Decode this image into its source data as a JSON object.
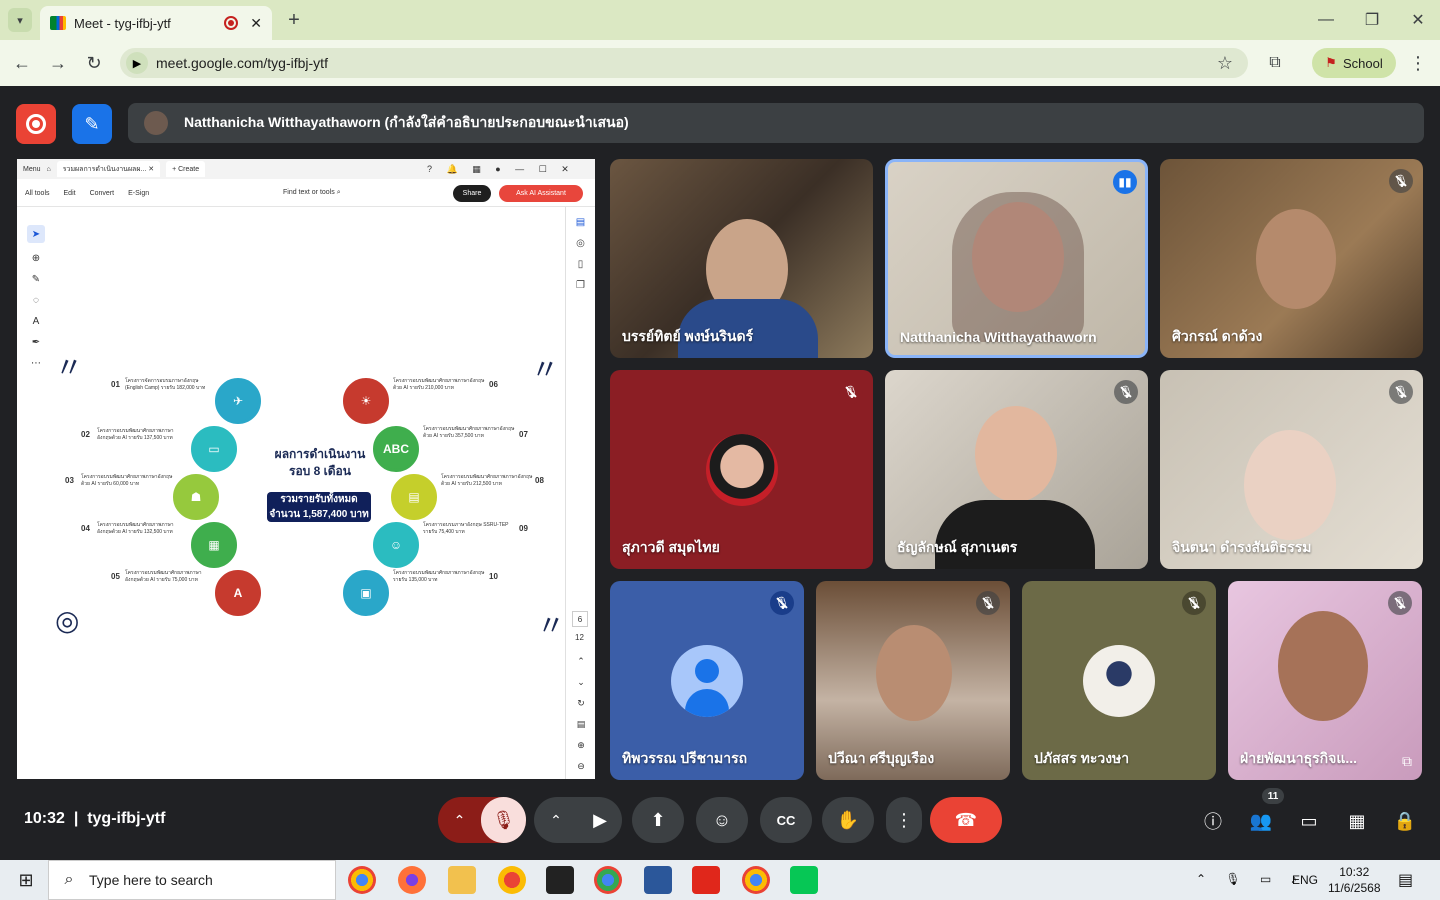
{
  "browser": {
    "tab_title": "Meet - tyg-ifbj-ytf",
    "url": "meet.google.com/tyg-ifbj-ytf",
    "profile_label": "School"
  },
  "meet": {
    "presenter_banner": "Natthanicha Witthayathaworn (กำลังใส่คำอธิบายประกอบขณะนำเสนอ)",
    "time": "10:32",
    "meeting_code": "tyg-ifbj-ytf",
    "participant_count": "11",
    "participants": [
      {
        "name": "บรรย์ทิตย์ พงษ์นรินดร์"
      },
      {
        "name": "Natthanicha Witthayathaworn"
      },
      {
        "name": "ศิวกรณ์ ดาด้วง"
      },
      {
        "name": "สุภาวดี สมุดไทย"
      },
      {
        "name": "ธัญลักษณ์ สุภาเนตร"
      },
      {
        "name": "จินตนา ดำรงสันติธรรม"
      },
      {
        "name": "ทิพวรรณ ปรีชามารถ"
      },
      {
        "name": "ปวีณา ศรีบุญเรือง"
      },
      {
        "name": "ปภัสสร ทะวงษา"
      },
      {
        "name": "ฝ่ายพัฒนาธุรกิจแ..."
      }
    ]
  },
  "acrobat": {
    "menu_label": "Menu",
    "doc_tab": "รวมผลการดำเนินงานผลผ...",
    "create_label": "+ Create",
    "menus": [
      "All tools",
      "Edit",
      "Convert",
      "E-Sign"
    ],
    "find_label": "Find text or tools",
    "share_label": "Share",
    "ai_label": "Ask AI Assistant",
    "page_number": "6",
    "page_total": "12"
  },
  "slide": {
    "title_line1": "ผลการดำเนินงาน",
    "title_line2": "รอบ 8 เดือน",
    "box_line1": "รวมรายรับทั้งหมด",
    "box_line2": "จำนวน 1,587,400 บาท",
    "items": [
      {
        "num": "01",
        "text": "โครงการจัดการอบรมภาษาอังกฤษ (English Camp) รายรับ 182,000 บาท"
      },
      {
        "num": "02",
        "text": "โครงการอบรมพัฒนาศักยภาพภาษาอังกฤษด้วย AI รายรับ 137,500 บาท"
      },
      {
        "num": "03",
        "text": "โครงการอบรมพัฒนาศักยภาพภาษาอังกฤษด้วย AI รายรับ 60,000 บาท"
      },
      {
        "num": "04",
        "text": "โครงการอบรมพัฒนาศักยภาพภาษาอังกฤษด้วย AI รายรับ 132,500 บาท"
      },
      {
        "num": "05",
        "text": "โครงการอบรมพัฒนาศักยภาพภาษาอังกฤษด้วย AI รายรับ 75,000 บาท"
      },
      {
        "num": "06",
        "text": "โครงการอบรมพัฒนาศักยภาพภาษาอังกฤษด้วย AI รายรับ 210,000 บาท"
      },
      {
        "num": "07",
        "text": "โครงการอบรมพัฒนาศักยภาพภาษาอังกฤษด้วย AI รายรับ 357,500 บาท"
      },
      {
        "num": "08",
        "text": "โครงการอบรมพัฒนาศักยภาพภาษาอังกฤษด้วย AI รายรับ 212,500 บาท"
      },
      {
        "num": "09",
        "text": "โครงการอบรมภาษาอังกฤษ SSRU-TEP รายรับ 75,400 บาท"
      },
      {
        "num": "10",
        "text": "โครงการอบรมพัฒนาศักยภาพภาษาอังกฤษ รายรับ 135,000 บาท"
      }
    ]
  },
  "taskbar": {
    "search_placeholder": "Type here to search",
    "lang": "ENG",
    "time": "10:32",
    "date": "11/6/2568"
  }
}
